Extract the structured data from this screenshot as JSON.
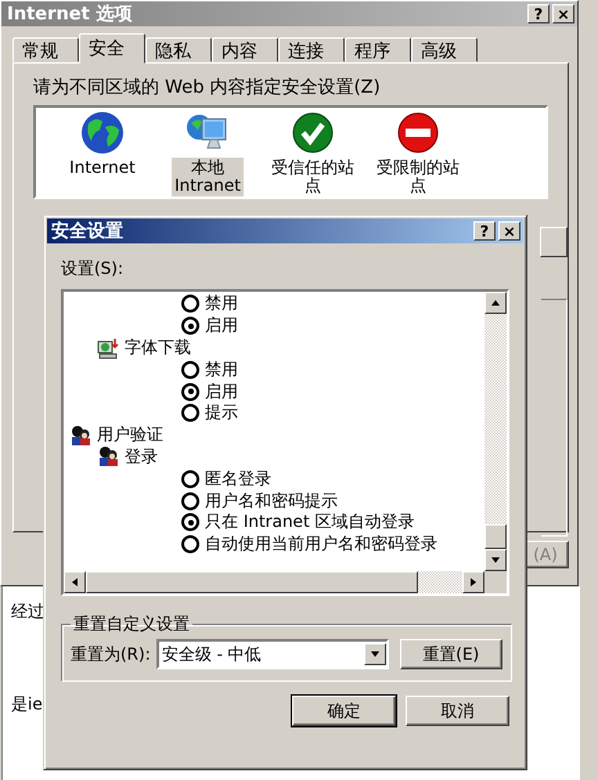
{
  "window": {
    "title": "Internet 选项",
    "help": "?",
    "close": "×"
  },
  "tabs": [
    {
      "label": "常规",
      "selected": false
    },
    {
      "label": "安全",
      "selected": true
    },
    {
      "label": "隐私",
      "selected": false
    },
    {
      "label": "内容",
      "selected": false
    },
    {
      "label": "连接",
      "selected": false
    },
    {
      "label": "程序",
      "selected": false
    },
    {
      "label": "高级",
      "selected": false
    }
  ],
  "zones_label": "请为不同区域的 Web 内容指定安全设置(Z)",
  "zones": [
    {
      "lines": [
        "Internet"
      ],
      "selected": false
    },
    {
      "lines": [
        "本地",
        "Intranet"
      ],
      "selected": true
    },
    {
      "lines": [
        "受信任的站",
        "点"
      ],
      "selected": false
    },
    {
      "lines": [
        "受限制的站",
        "点"
      ],
      "selected": false
    }
  ],
  "apply_button": "(A)",
  "page_lines": [
    "经过",
    "是ie"
  ],
  "dialog": {
    "title": "安全设置",
    "help": "?",
    "close": "×",
    "settings_label": "设置(S):",
    "tree": [
      {
        "kind": "continued",
        "children": [
          {
            "kind": "continued",
            "children": [
              {
                "kind": "radio",
                "label": "禁用",
                "selected": false
              },
              {
                "kind": "radio",
                "label": "启用",
                "selected": true
              }
            ]
          },
          {
            "kind": "download_group",
            "label": "字体下载",
            "children": [
              {
                "kind": "radio",
                "label": "禁用",
                "selected": false
              },
              {
                "kind": "radio",
                "label": "启用",
                "selected": true
              },
              {
                "kind": "radio",
                "label": "提示",
                "selected": false
              }
            ]
          }
        ]
      },
      {
        "kind": "auth_group",
        "label": "用户验证",
        "children": [
          {
            "kind": "auth_group",
            "label": "登录",
            "children": [
              {
                "kind": "radio",
                "label": "匿名登录",
                "selected": false
              },
              {
                "kind": "radio",
                "label": "用户名和密码提示",
                "selected": false
              },
              {
                "kind": "radio",
                "label": "只在 Intranet 区域自动登录",
                "selected": true
              },
              {
                "kind": "radio",
                "label": "自动使用当前用户名和密码登录",
                "selected": false
              }
            ]
          }
        ]
      }
    ],
    "reset_group": {
      "title": "重置自定义设置",
      "label": "重置为(R):",
      "value": "安全级 - 中低",
      "button": "重置(E)"
    },
    "buttons": [
      "确定",
      "取消"
    ]
  }
}
